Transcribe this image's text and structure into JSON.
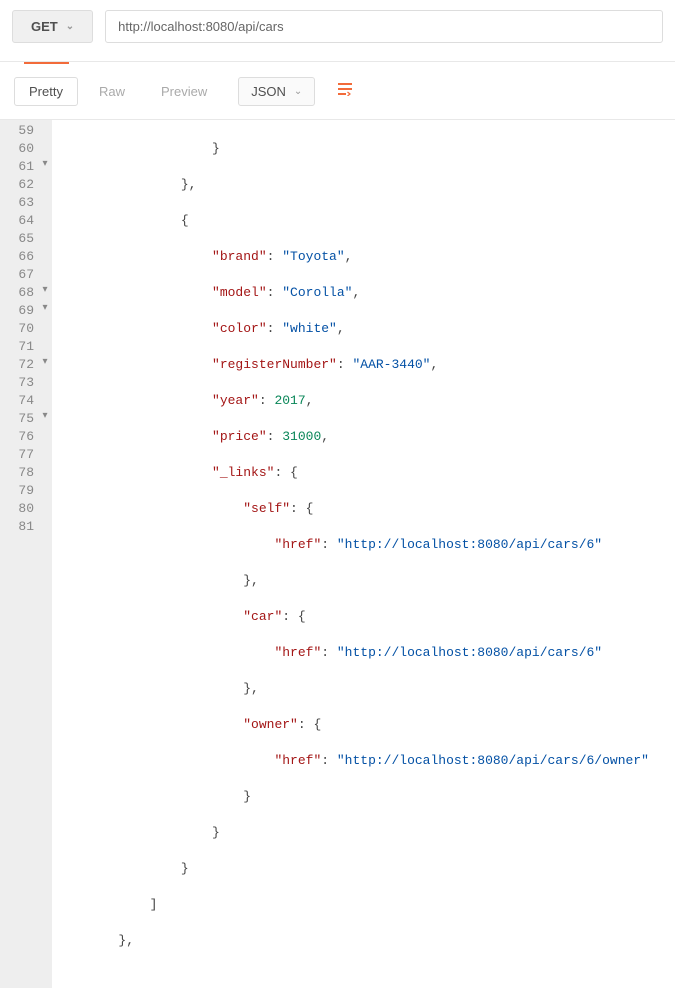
{
  "request": {
    "method": "GET",
    "url": "http://localhost:8080/api/cars"
  },
  "toolbar": {
    "tabs": {
      "pretty": "Pretty",
      "raw": "Raw",
      "preview": "Preview"
    },
    "format": "JSON",
    "wrap_icon": "⇄"
  },
  "gutter": {
    "l59": "59",
    "l60": "60",
    "l61": "61",
    "l62": "62",
    "l63": "63",
    "l64": "64",
    "l65": "65",
    "l66": "66",
    "l67": "67",
    "l68": "68",
    "l69": "69",
    "l70": "70",
    "l71": "71",
    "l72": "72",
    "l73": "73",
    "l74": "74",
    "l75": "75",
    "l76": "76",
    "l77": "77",
    "l78": "78",
    "l79": "79",
    "l80": "80",
    "l81": "81"
  },
  "fold": {
    "mark": "▾"
  },
  "json_body": {
    "brand_key": "\"brand\"",
    "brand_val": "\"Toyota\"",
    "model_key": "\"model\"",
    "model_val": "\"Corolla\"",
    "color_key": "\"color\"",
    "color_val": "\"white\"",
    "regnum_key": "\"registerNumber\"",
    "regnum_val": "\"AAR-3440\"",
    "year_key": "\"year\"",
    "year_val": "2017",
    "price_key": "\"price\"",
    "price_val": "31000",
    "links_key": "\"_links\"",
    "self_key": "\"self\"",
    "href_key1": "\"href\"",
    "href_val1": "\"http://localhost:8080/api/cars/6\"",
    "car_key": "\"car\"",
    "href_key2": "\"href\"",
    "href_val2": "\"http://localhost:8080/api/cars/6\"",
    "owner_key": "\"owner\"",
    "href_key3": "\"href\"",
    "href_val3": "\"http://localhost:8080/api/cars/6/owner\"",
    "close_brace": "}",
    "close_brace_comma": "},",
    "open_brace": "{",
    "close_bracket": "]",
    "colon": ": ",
    "colon_brace": ": {",
    "comma": ","
  },
  "chevron": "⌄"
}
